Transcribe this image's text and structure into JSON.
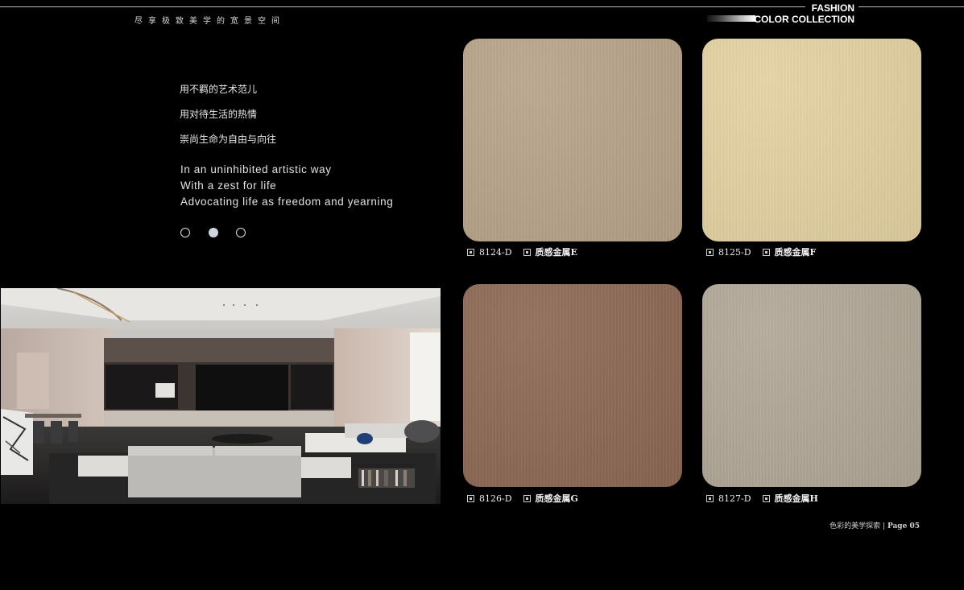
{
  "header": {
    "tagline": "尽享极致美学的宽景空间",
    "brand_line1": "FASHION",
    "brand_line2": "COLOR COLLECTION"
  },
  "intro": {
    "cn_lines": [
      "用不羁的艺术范儿",
      "用对待生活的热情",
      "崇尚生命为自由与向往"
    ],
    "en_lines": [
      "In an uninhibited artistic way",
      "With a zest for life",
      "Advocating life as freedom and yearning"
    ],
    "pager_active_index": 1
  },
  "swatches": [
    {
      "code": "8124-D",
      "name": "质感金属E",
      "color": "#b7a388"
    },
    {
      "code": "8125-D",
      "name": "质感金属F",
      "color": "#e4d2a0"
    },
    {
      "code": "8126-D",
      "name": "质感金属G",
      "color": "#8c6752"
    },
    {
      "code": "8127-D",
      "name": "质感金属H",
      "color": "#b1a796"
    }
  ],
  "footer": {
    "section": "色彩的美学探索",
    "separator": "|",
    "page": "Page 05"
  }
}
